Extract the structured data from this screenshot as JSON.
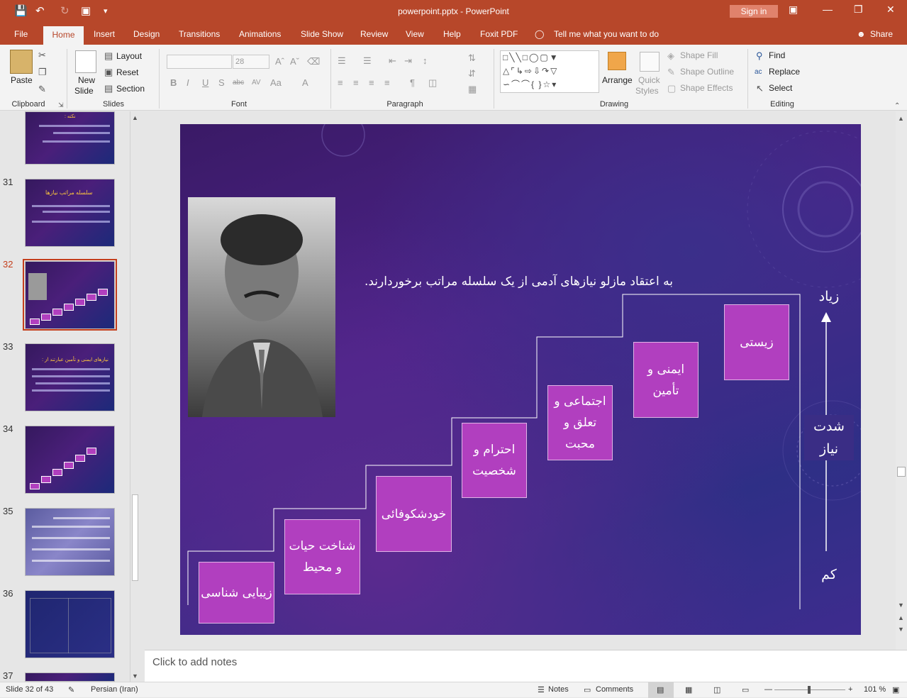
{
  "titlebar": {
    "doc_title": "powerpoint.pptx  -  PowerPoint",
    "signin": "Sign in"
  },
  "tabs": {
    "file": "File",
    "home": "Home",
    "insert": "Insert",
    "design": "Design",
    "transitions": "Transitions",
    "animations": "Animations",
    "slideshow": "Slide Show",
    "review": "Review",
    "view": "View",
    "help": "Help",
    "foxit": "Foxit PDF",
    "tellme": "Tell me what you want to do",
    "share": "Share"
  },
  "ribbon": {
    "clipboard": {
      "paste": "Paste",
      "label": "Clipboard"
    },
    "slides": {
      "new_slide_1": "New",
      "new_slide_2": "Slide",
      "layout": "Layout",
      "reset": "Reset",
      "section": "Section",
      "label": "Slides"
    },
    "font": {
      "font_size": "28",
      "label": "Font"
    },
    "paragraph": {
      "label": "Paragraph"
    },
    "drawing": {
      "arrange": "Arrange",
      "quick_styles_1": "Quick",
      "quick_styles_2": "Styles",
      "shape_fill": "Shape Fill",
      "shape_outline": "Shape Outline",
      "shape_effects": "Shape Effects",
      "label": "Drawing"
    },
    "editing": {
      "find": "Find",
      "replace": "Replace",
      "select": "Select",
      "label": "Editing"
    }
  },
  "thumbnails": [
    {
      "num": "",
      "title": "نکته :"
    },
    {
      "num": "31",
      "title": "سلسله مراتب نیازها"
    },
    {
      "num": "32",
      "title": ""
    },
    {
      "num": "33",
      "title": "نیازهای ایمنی و تأمین عبارتند از :"
    },
    {
      "num": "34",
      "title": ""
    },
    {
      "num": "35",
      "title": ""
    },
    {
      "num": "36",
      "title": ""
    },
    {
      "num": "37",
      "title": ""
    }
  ],
  "slide": {
    "statement": "به اعتقاد مازلو نیازهای آدمی از یک سلسله مراتب برخوردارند.",
    "boxes": [
      {
        "text": "زیبایی شناسی"
      },
      {
        "text": "شناخت حیات و محیط"
      },
      {
        "text": "خودشکوفائی"
      },
      {
        "text": "احترام و شخصیت"
      },
      {
        "text": "اجتماعی و تعلق و محبت"
      },
      {
        "text": "ایمنی و تأمین"
      },
      {
        "text": "زیستی"
      }
    ],
    "axis": {
      "top": "زیاد",
      "middle": "شدت نیاز",
      "bottom": "کم"
    }
  },
  "notes": {
    "placeholder": "Click to add notes"
  },
  "status": {
    "slide_of": "Slide 32 of 43",
    "language": "Persian (Iran)",
    "notes": "Notes",
    "comments": "Comments",
    "zoom": "101 %"
  }
}
